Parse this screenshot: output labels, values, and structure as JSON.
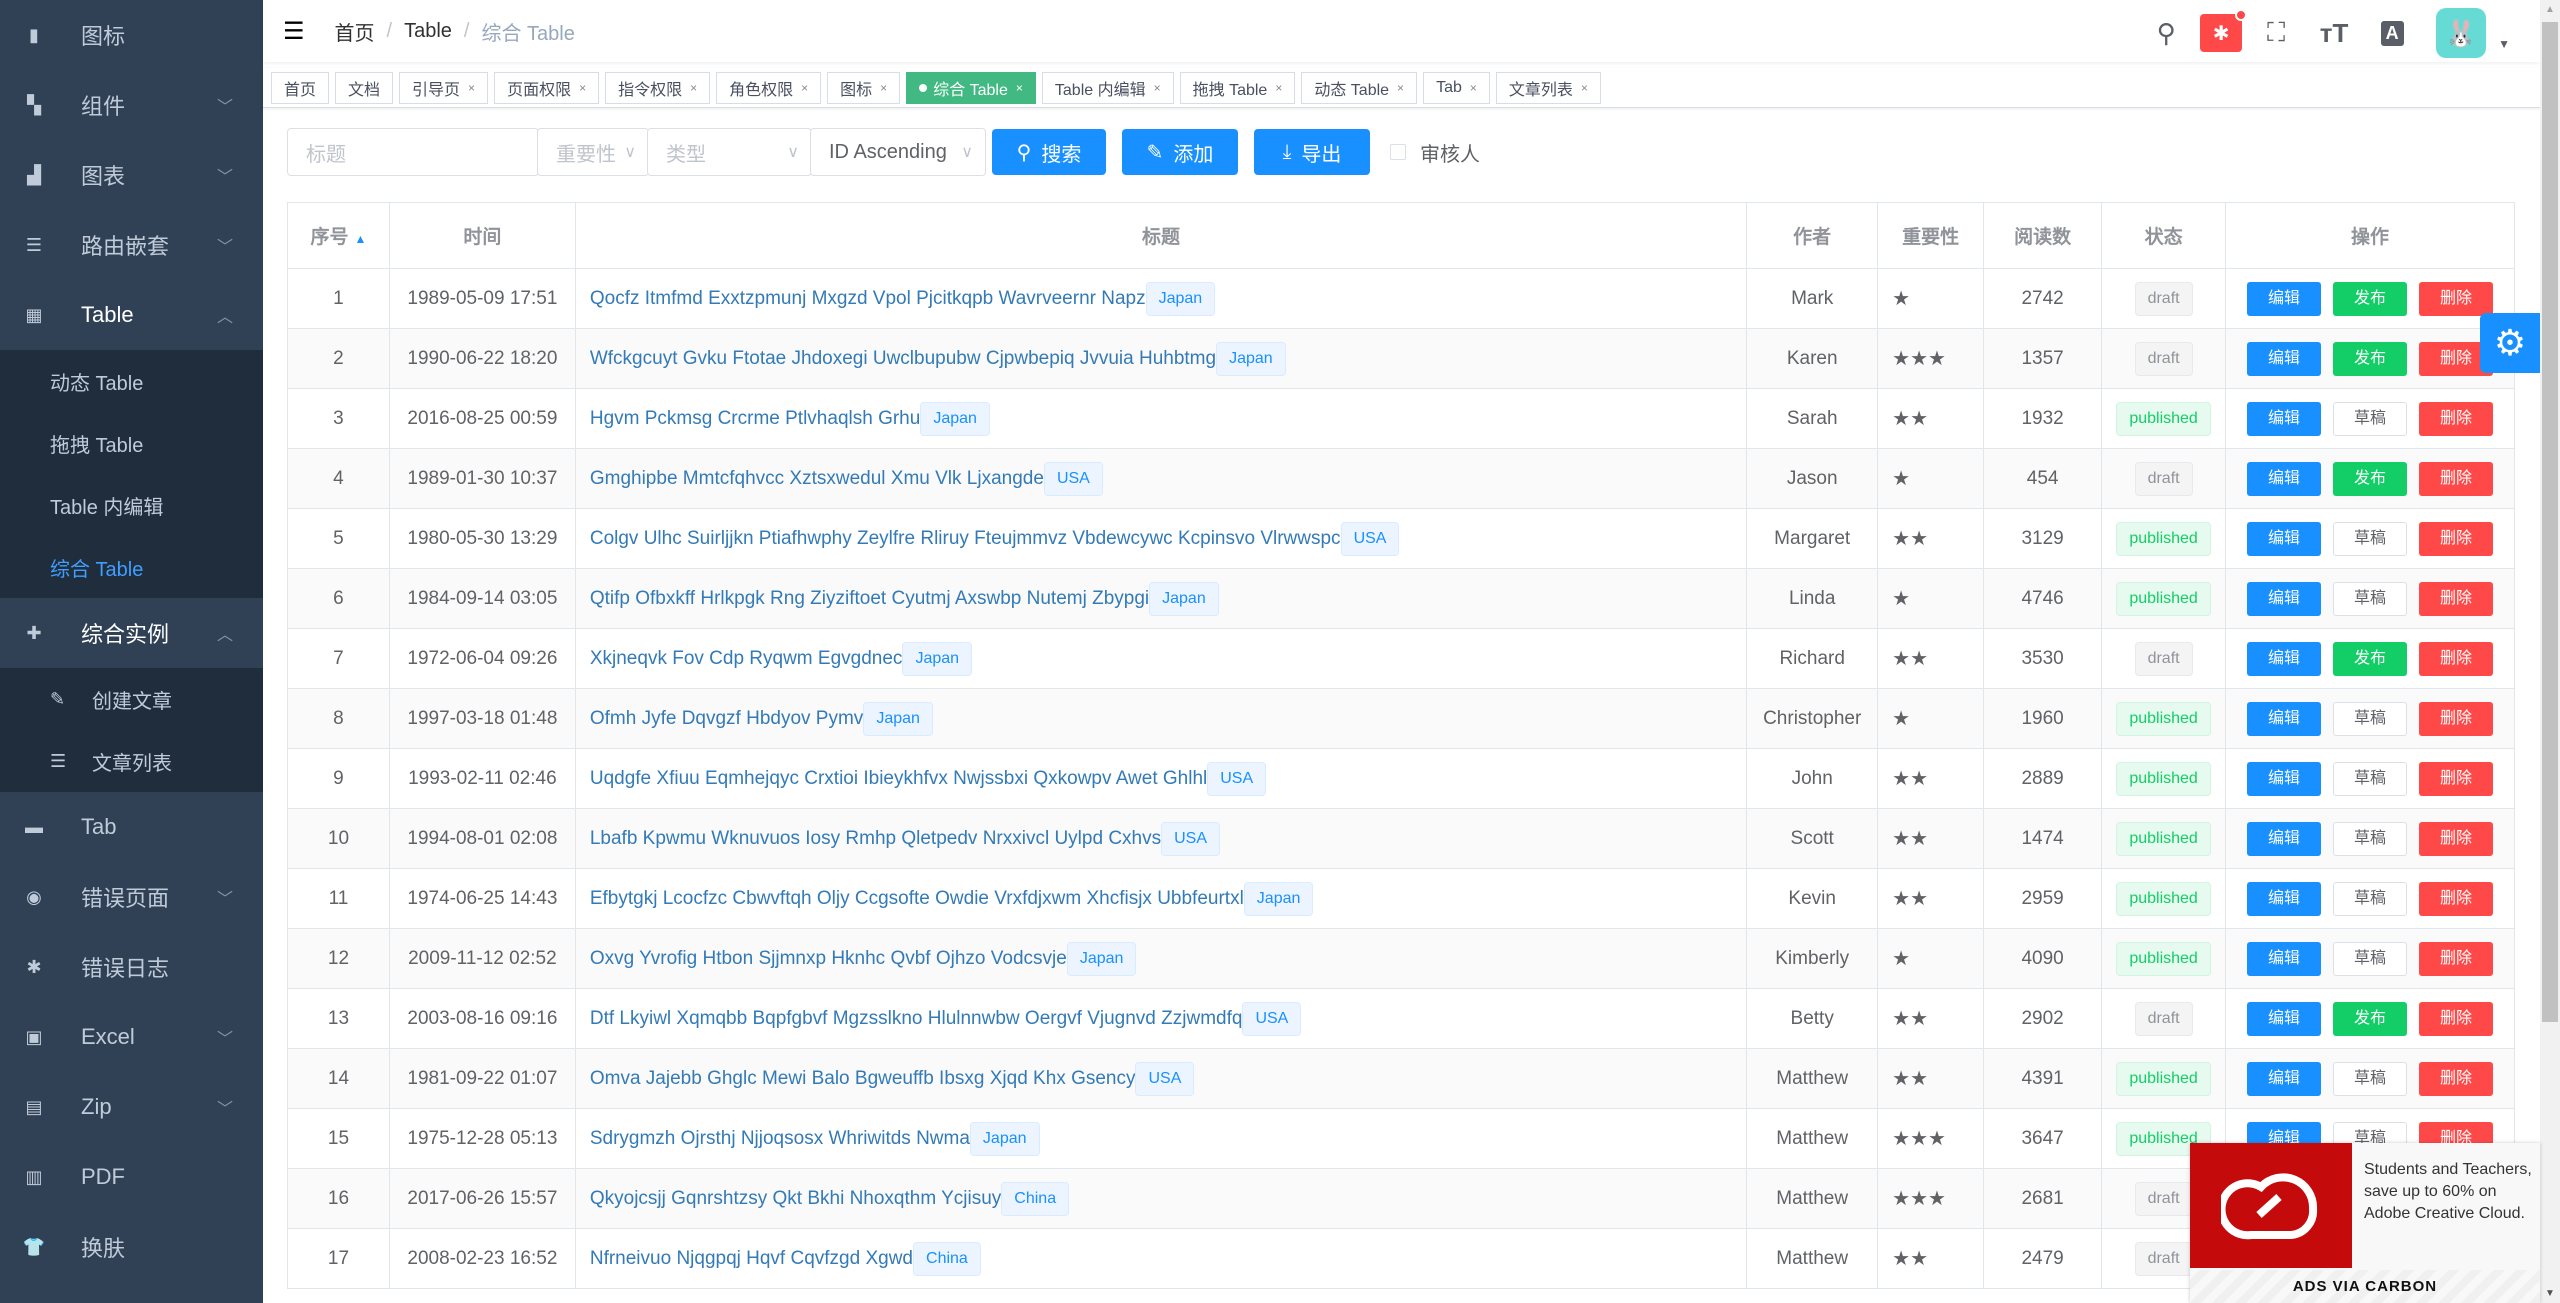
{
  "sidebar": {
    "items": [
      {
        "label": "图标",
        "icon": "icon-icon",
        "chev": ""
      },
      {
        "label": "组件",
        "icon": "component-icon",
        "chev": "down"
      },
      {
        "label": "图表",
        "icon": "chart-icon",
        "chev": "down"
      },
      {
        "label": "路由嵌套",
        "icon": "nested-icon",
        "chev": "down"
      },
      {
        "label": "Table",
        "icon": "table-icon",
        "chev": "up",
        "open": true,
        "children": [
          {
            "label": "动态 Table"
          },
          {
            "label": "拖拽 Table"
          },
          {
            "label": "Table 内编辑"
          },
          {
            "label": "综合 Table",
            "active": true
          }
        ]
      },
      {
        "label": "综合实例",
        "icon": "example-icon",
        "chev": "up",
        "open": true,
        "children": [
          {
            "label": "创建文章",
            "icon": "edit-icon"
          },
          {
            "label": "文章列表",
            "icon": "list-icon"
          }
        ]
      },
      {
        "label": "Tab",
        "icon": "tab-icon",
        "chev": ""
      },
      {
        "label": "错误页面",
        "icon": "404-icon",
        "chev": "down"
      },
      {
        "label": "错误日志",
        "icon": "bug-icon",
        "chev": ""
      },
      {
        "label": "Excel",
        "icon": "excel-icon",
        "chev": "down"
      },
      {
        "label": "Zip",
        "icon": "zip-icon",
        "chev": "down"
      },
      {
        "label": "PDF",
        "icon": "pdf-icon",
        "chev": ""
      },
      {
        "label": "换肤",
        "icon": "skin-icon",
        "chev": ""
      }
    ]
  },
  "navbar": {
    "breadcrumb": [
      "首页",
      "Table",
      "综合 Table"
    ]
  },
  "tags": [
    {
      "label": "首页",
      "closable": false
    },
    {
      "label": "文档",
      "closable": false
    },
    {
      "label": "引导页",
      "closable": true
    },
    {
      "label": "页面权限",
      "closable": true
    },
    {
      "label": "指令权限",
      "closable": true
    },
    {
      "label": "角色权限",
      "closable": true
    },
    {
      "label": "图标",
      "closable": true
    },
    {
      "label": "综合 Table",
      "closable": true,
      "active": true
    },
    {
      "label": "Table 内编辑",
      "closable": true
    },
    {
      "label": "拖拽 Table",
      "closable": true
    },
    {
      "label": "动态 Table",
      "closable": true
    },
    {
      "label": "Tab",
      "closable": true
    },
    {
      "label": "文章列表",
      "closable": true
    }
  ],
  "filter": {
    "title_placeholder": "标题",
    "importance_placeholder": "重要性",
    "type_placeholder": "类型",
    "sort_value": "ID Ascending",
    "search": "搜索",
    "add": "添加",
    "export": "导出",
    "reviewer": "审核人"
  },
  "table": {
    "columns": [
      "序号",
      "时间",
      "标题",
      "作者",
      "重要性",
      "阅读数",
      "状态",
      "操作"
    ],
    "actions": {
      "edit": "编辑",
      "publish": "发布",
      "draft": "草稿",
      "delete": "删除"
    },
    "rows": [
      {
        "id": 1,
        "time": "1989-05-09 17:51",
        "title": "Qocfz Itmfmd Exxtzpmunj Mxgzd Vpol Pjcitkqpb Wavrveernr Napz",
        "tag": "Japan",
        "author": "Mark",
        "importance": 1,
        "reads": 2742,
        "status": "draft"
      },
      {
        "id": 2,
        "time": "1990-06-22 18:20",
        "title": "Wfckgcuyt Gvku Ftotae Jhdoxegi Uwclbupubw Cjpwbepiq Jvvuia Huhbtmg",
        "tag": "Japan",
        "author": "Karen",
        "importance": 3,
        "reads": 1357,
        "status": "draft"
      },
      {
        "id": 3,
        "time": "2016-08-25 00:59",
        "title": "Hgvm Pckmsg Crcrme Ptlvhaqlsh Grhu",
        "tag": "Japan",
        "author": "Sarah",
        "importance": 2,
        "reads": 1932,
        "status": "published"
      },
      {
        "id": 4,
        "time": "1989-01-30 10:37",
        "title": "Gmghipbe Mmtcfqhvcc Xztsxwedul Xmu Vlk Ljxangde",
        "tag": "USA",
        "author": "Jason",
        "importance": 1,
        "reads": 454,
        "status": "draft"
      },
      {
        "id": 5,
        "time": "1980-05-30 13:29",
        "title": "Colgv Ulhc Suirljjkn Ptiafhwphy Zeylfre Rliruy Fteujmmvz Vbdewcywc Kcpinsvo Vlrwwspc",
        "tag": "USA",
        "author": "Margaret",
        "importance": 2,
        "reads": 3129,
        "status": "published"
      },
      {
        "id": 6,
        "time": "1984-09-14 03:05",
        "title": "Qtifp Ofbxkff Hrlkpgk Rng Ziyziftoet Cyutmj Axswbp Nutemj Zbypgi",
        "tag": "Japan",
        "author": "Linda",
        "importance": 1,
        "reads": 4746,
        "status": "published"
      },
      {
        "id": 7,
        "time": "1972-06-04 09:26",
        "title": "Xkjneqvk Fov Cdp Ryqwm Egvgdnec",
        "tag": "Japan",
        "author": "Richard",
        "importance": 2,
        "reads": 3530,
        "status": "draft"
      },
      {
        "id": 8,
        "time": "1997-03-18 01:48",
        "title": "Ofmh Jyfe Dqvgzf Hbdyov Pymv",
        "tag": "Japan",
        "author": "Christopher",
        "importance": 1,
        "reads": 1960,
        "status": "published"
      },
      {
        "id": 9,
        "time": "1993-02-11 02:46",
        "title": "Uqdgfe Xfiuu Eqmhejqyc Crxtioi Ibieykhfvx Nwjssbxi Qxkowpv Awet Ghlhl",
        "tag": "USA",
        "author": "John",
        "importance": 2,
        "reads": 2889,
        "status": "published"
      },
      {
        "id": 10,
        "time": "1994-08-01 02:08",
        "title": "Lbafb Kpwmu Wknuvuos Iosy Rmhp Qletpedv Nrxxivcl Uylpd Cxhvs",
        "tag": "USA",
        "author": "Scott",
        "importance": 2,
        "reads": 1474,
        "status": "published"
      },
      {
        "id": 11,
        "time": "1974-06-25 14:43",
        "title": "Efbytgkj Lcocfzc Cbwvftqh Oljy Ccgsofte Owdie Vrxfdjxwm Xhcfisjx Ubbfeurtxl",
        "tag": "Japan",
        "author": "Kevin",
        "importance": 2,
        "reads": 2959,
        "status": "published"
      },
      {
        "id": 12,
        "time": "2009-11-12 02:52",
        "title": "Oxvg Yvrofig Htbon Sjjmnxp Hknhc Qvbf Ojhzo Vodcsvje",
        "tag": "Japan",
        "author": "Kimberly",
        "importance": 1,
        "reads": 4090,
        "status": "published"
      },
      {
        "id": 13,
        "time": "2003-08-16 09:16",
        "title": "Dtf Lkyiwl Xqmqbb Bqpfgbvf Mgzsslkno Hlulnnwbw Oergvf Vjugnvd Zzjwmdfq",
        "tag": "USA",
        "author": "Betty",
        "importance": 2,
        "reads": 2902,
        "status": "draft"
      },
      {
        "id": 14,
        "time": "1981-09-22 01:07",
        "title": "Omva Jajebb Ghglc Mewi Balo Bgweuffb Ibsxg Xjqd Khx Gsency",
        "tag": "USA",
        "author": "Matthew",
        "importance": 2,
        "reads": 4391,
        "status": "published"
      },
      {
        "id": 15,
        "time": "1975-12-28 05:13",
        "title": "Sdrygmzh Ojrsthj Njjoqsosx Whriwitds Nwma",
        "tag": "Japan",
        "author": "Matthew",
        "importance": 3,
        "reads": 3647,
        "status": "published"
      },
      {
        "id": 16,
        "time": "2017-06-26 15:57",
        "title": "Qkyojcsjj Gqnrshtzsy Qkt Bkhi Nhoxqthm Ycjisuy",
        "tag": "China",
        "author": "Matthew",
        "importance": 3,
        "reads": 2681,
        "status": "draft"
      },
      {
        "id": 17,
        "time": "2008-02-23 16:52",
        "title": "Nfrneivuo Njqgpqj Hqvf Cqvfzgd Xgwd",
        "tag": "China",
        "author": "Matthew",
        "importance": 2,
        "reads": 2479,
        "status": "draft"
      }
    ]
  },
  "ad": {
    "text": "Students and Teachers, save up to 60% on Adobe Creative Cloud.",
    "via": "ADS VIA CARBON"
  },
  "colors": {
    "primary": "#1890ff",
    "success": "#13ce66",
    "danger": "#ff4949",
    "sidebar": "#304156",
    "active_tag": "#42b983"
  }
}
